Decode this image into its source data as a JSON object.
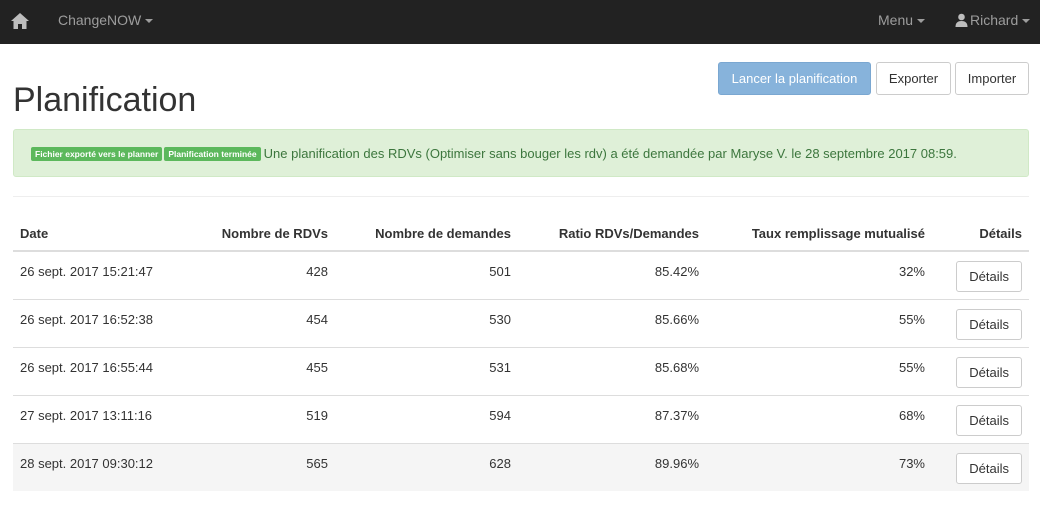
{
  "navbar": {
    "brand": "ChangeNOW",
    "menu": "Menu",
    "user": "Richard"
  },
  "header": {
    "title": "Planification",
    "launch_button": "Lancer la planification",
    "export_button": "Exporter",
    "import_button": "Importer"
  },
  "alert": {
    "label_exported": "Fichier exporté vers le planner",
    "label_done": "Planification terminée",
    "message": "Une planification des RDVs (Optimiser sans bouger les rdv) a été demandée par Maryse V. le 28 septembre 2017 08:59."
  },
  "table": {
    "headers": {
      "date": "Date",
      "rdvs": "Nombre de RDVs",
      "demandes": "Nombre de demandes",
      "ratio": "Ratio RDVs/Demandes",
      "taux": "Taux remplissage mutualisé",
      "details": "Détails"
    },
    "rows": [
      {
        "date": "26 sept. 2017 15:21:47",
        "rdvs": "428",
        "demandes": "501",
        "ratio": "85.42%",
        "taux": "32%",
        "details": "Détails"
      },
      {
        "date": "26 sept. 2017 16:52:38",
        "rdvs": "454",
        "demandes": "530",
        "ratio": "85.66%",
        "taux": "55%",
        "details": "Détails"
      },
      {
        "date": "26 sept. 2017 16:55:44",
        "rdvs": "455",
        "demandes": "531",
        "ratio": "85.68%",
        "taux": "55%",
        "details": "Détails"
      },
      {
        "date": "27 sept. 2017 13:11:16",
        "rdvs": "519",
        "demandes": "594",
        "ratio": "87.37%",
        "taux": "68%",
        "details": "Détails"
      },
      {
        "date": "28 sept. 2017 09:30:12",
        "rdvs": "565",
        "demandes": "628",
        "ratio": "89.96%",
        "taux": "73%",
        "details": "Détails"
      }
    ]
  },
  "colors": {
    "navbar_bg": "#222222",
    "primary_button": "#87b3db",
    "alert_bg": "#dff0d8",
    "alert_text": "#3c763d",
    "label_green": "#5cb85c"
  }
}
